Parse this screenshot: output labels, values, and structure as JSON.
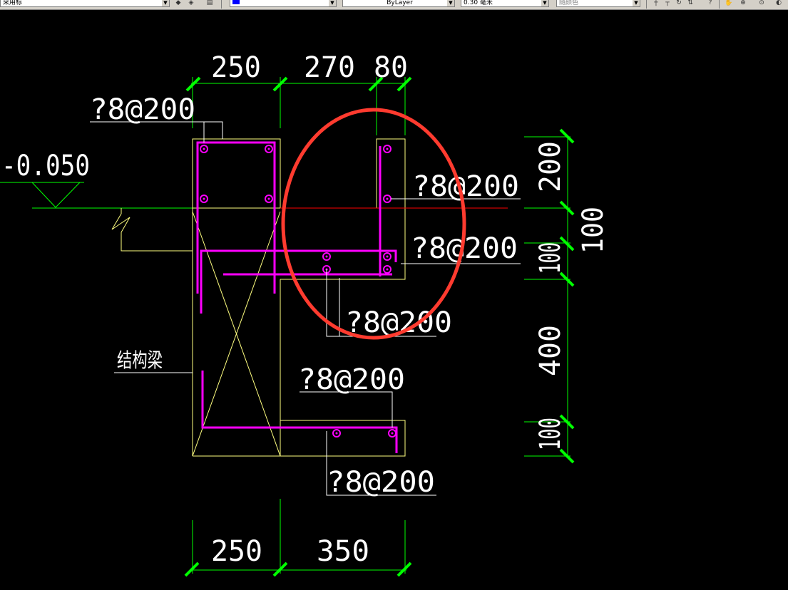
{
  "toolbar": {
    "layer_combo": "采用标",
    "layer_combo_2": "",
    "color_combo": "",
    "linetype_combo": "ByLayer",
    "lineweight_combo": "0.30 毫米",
    "plotstyle_combo": "随颜色"
  },
  "drawing": {
    "top_dims": [
      "250",
      "270",
      "80"
    ],
    "bottom_dims": [
      "250",
      "350"
    ],
    "right_dims": [
      "200",
      "100",
      "400",
      "100"
    ],
    "right_outer_dim": "100",
    "elevation": "-0.050",
    "rebar_labels": [
      "?8@200",
      "?8@200",
      "?8@200",
      "?8@200",
      "?8@200",
      "?8@200"
    ],
    "beam_label": "结构梁"
  },
  "colors": {
    "background": "#000000",
    "rebar": "#ff00ff",
    "outline": "#ffff80",
    "dim_line": "#00ff00",
    "dim_tick": "#00ff00",
    "text": "#ffffff",
    "highlight": "#ff3b2f",
    "centerline": "#ff0000"
  }
}
